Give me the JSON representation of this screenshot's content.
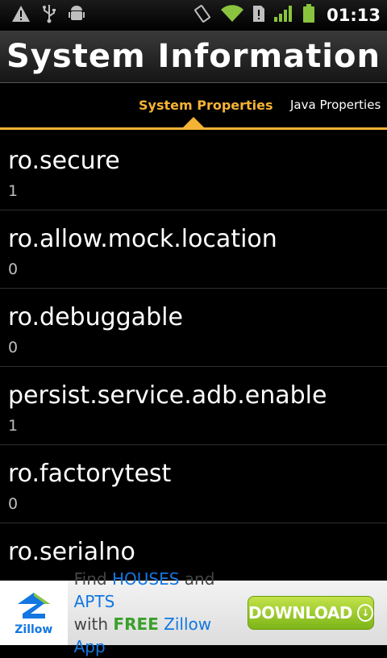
{
  "status_bar": {
    "time": "01:13",
    "left_icons": [
      "warning-icon",
      "usb-icon",
      "android-debug-icon"
    ],
    "right_icons": [
      "vibrate-icon",
      "wifi-icon",
      "sim-alert-icon",
      "signal-icon",
      "battery-icon"
    ],
    "accent": "#8ac43f"
  },
  "title": "System Information",
  "tabs": {
    "active": "System Properties",
    "inactive": "Java Properties",
    "accent": "#f5b335"
  },
  "properties": [
    {
      "key": "ro.secure",
      "value": "1"
    },
    {
      "key": "ro.allow.mock.location",
      "value": "0"
    },
    {
      "key": "ro.debuggable",
      "value": "0"
    },
    {
      "key": "persist.service.adb.enable",
      "value": "1"
    },
    {
      "key": "ro.factorytest",
      "value": "0"
    },
    {
      "key": "ro.serialno",
      "value": ""
    }
  ],
  "ad": {
    "logo_text": "Zillow",
    "line1_a": "Find ",
    "line1_b": "HOUSES",
    "line1_c": " and ",
    "line1_d": "APTS",
    "line2_a": "with ",
    "line2_b": "FREE",
    "line2_c": " Zillow App",
    "button": "DOWNLOAD"
  }
}
